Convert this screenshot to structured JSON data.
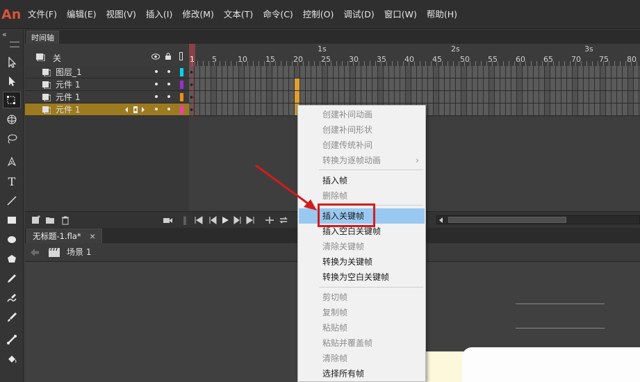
{
  "app": {
    "logo": "An"
  },
  "menu": {
    "items": [
      "文件(F)",
      "编辑(E)",
      "视图(V)",
      "插入(I)",
      "修改(M)",
      "文本(T)",
      "命令(C)",
      "控制(O)",
      "调试(D)",
      "窗口(W)",
      "帮助(H)"
    ]
  },
  "toolbar": {
    "collapse_glyph": "«",
    "tools": [
      "selection-icon",
      "subselection-icon",
      "free-transform-icon",
      "3d-rotation-icon",
      "lasso-icon",
      "pen-icon",
      "text-icon",
      "line-icon",
      "rectangle-icon",
      "oval-icon",
      "polystar-icon",
      "pencil-icon",
      "brush-icon",
      "paint-brush-icon",
      "bone-icon",
      "paint-bucket-icon"
    ]
  },
  "timeline": {
    "tab_label": "时间轴",
    "header_label": "关",
    "ruler": {
      "frame_numbers": [
        "1",
        "5",
        "10",
        "15",
        "20",
        "25",
        "30",
        "35",
        "40",
        "45",
        "50",
        "55",
        "60",
        "65",
        "70",
        "75",
        "80"
      ],
      "seconds": [
        "1s",
        "2s",
        "3s"
      ]
    },
    "layers": [
      {
        "name": "图层_1",
        "color": "#00d8f0",
        "selected": false
      },
      {
        "name": "元件 1",
        "color": "#9a2fd0",
        "selected": false
      },
      {
        "name": "元件 1",
        "color": "#f08a18",
        "selected": false
      },
      {
        "name": "元件 1",
        "color": "#f03cb8",
        "selected": true
      }
    ]
  },
  "document": {
    "tab_label": "无标题-1.fla*",
    "close_glyph": "×",
    "scene_label": "场景 1"
  },
  "context_menu": {
    "items": [
      {
        "label": "创建补间动画",
        "state": "disabled"
      },
      {
        "label": "创建补间形状",
        "state": "disabled"
      },
      {
        "label": "创建传统补间",
        "state": "disabled"
      },
      {
        "label": "转换为逐帧动画",
        "state": "disabled",
        "submenu": true
      },
      {
        "label": "插入帧",
        "state": "enabled"
      },
      {
        "label": "删除帧",
        "state": "disabled"
      },
      {
        "label": "插入关键帧",
        "state": "highlighted"
      },
      {
        "label": "插入空白关键帧",
        "state": "enabled"
      },
      {
        "label": "清除关键帧",
        "state": "disabled"
      },
      {
        "label": "转换为关键帧",
        "state": "enabled"
      },
      {
        "label": "转换为空白关键帧",
        "state": "enabled"
      },
      {
        "label": "剪切帧",
        "state": "disabled"
      },
      {
        "label": "复制帧",
        "state": "disabled"
      },
      {
        "label": "粘贴帧",
        "state": "disabled"
      },
      {
        "label": "粘贴并覆盖帧",
        "state": "disabled"
      },
      {
        "label": "清除帧",
        "state": "disabled"
      },
      {
        "label": "选择所有帧",
        "state": "enabled"
      }
    ],
    "submenu_glyph": "›"
  },
  "colors": {
    "accent_selected_layer": "#9c7a1f",
    "keyframe_orange": "#e0a030",
    "playhead": "#c83030",
    "annotation_red": "#d41b1b",
    "menu_highlight": "#99c9f1"
  }
}
